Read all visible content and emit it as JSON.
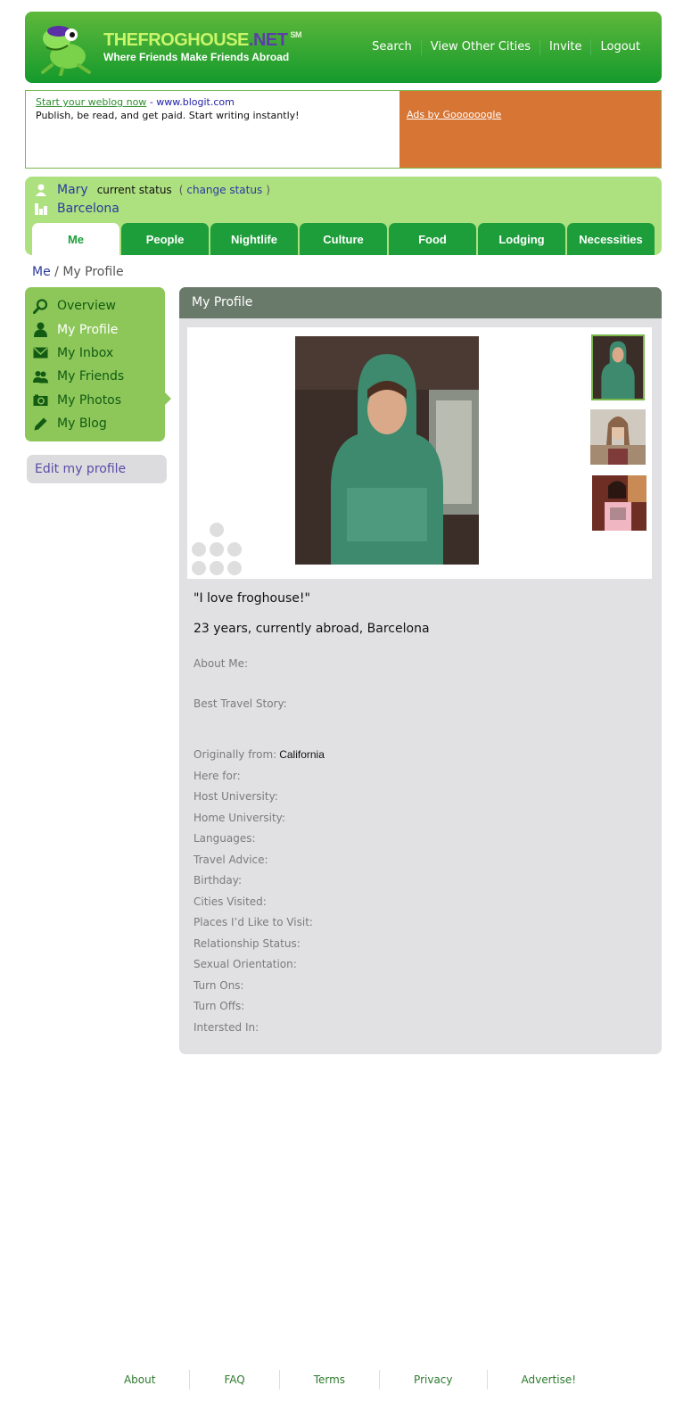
{
  "header": {
    "brand_main": "THEFROGHOUSE",
    "brand_net": ".NET",
    "brand_sm": "SM",
    "tagline": "Where Friends Make Friends Abroad",
    "nav": [
      "Search",
      "View Other Cities",
      "Invite",
      "Logout"
    ]
  },
  "ad": {
    "link_text": "Start your weblog now",
    "url_text": "- www.blogit.com",
    "body": "Publish, be read, and get paid. Start writing instantly!",
    "ads_by": "Ads by Goooooogle"
  },
  "user": {
    "name": "Mary",
    "status_label": "current status",
    "open_paren": "(",
    "change_status": "change status",
    "close_paren": ")",
    "city": "Barcelona"
  },
  "tabs": [
    "Me",
    "People",
    "Nightlife",
    "Culture",
    "Food",
    "Lodging",
    "Necessities"
  ],
  "breadcrumb": {
    "link": "Me",
    "separator": "/",
    "current": "My Profile"
  },
  "sidebar": {
    "items": [
      {
        "label": "Overview",
        "icon": "magnifier-icon"
      },
      {
        "label": "My Profile",
        "icon": "person-icon"
      },
      {
        "label": "My Inbox",
        "icon": "envelope-icon"
      },
      {
        "label": "My Friends",
        "icon": "friends-icon"
      },
      {
        "label": "My Photos",
        "icon": "camera-icon"
      },
      {
        "label": "My Blog",
        "icon": "pencil-icon"
      }
    ],
    "active_index": 1,
    "edit_profile": "Edit my profile"
  },
  "profile": {
    "panel_title": "My Profile",
    "quote": "\"I love froghouse!\"",
    "summary": "23 years, currently abroad, Barcelona",
    "about_me_label": "About Me:",
    "travel_story_label": "Best Travel Story:",
    "fields": [
      {
        "label": "Originally from:",
        "value": "California"
      },
      {
        "label": "Here for:",
        "value": ""
      },
      {
        "label": "Host University:",
        "value": ""
      },
      {
        "label": "Home University:",
        "value": ""
      },
      {
        "label": "Languages:",
        "value": ""
      },
      {
        "label": "Travel Advice:",
        "value": ""
      },
      {
        "label": "Birthday:",
        "value": ""
      },
      {
        "label": "Cities Visited:",
        "value": ""
      },
      {
        "label": "Places I’d Like to Visit:",
        "value": ""
      },
      {
        "label": "Relationship Status:",
        "value": ""
      },
      {
        "label": "Sexual Orientation:",
        "value": ""
      },
      {
        "label": "Turn Ons:",
        "value": ""
      },
      {
        "label": "Turn Offs:",
        "value": ""
      },
      {
        "label": "Intersted In:",
        "value": ""
      }
    ]
  },
  "footer": [
    "About",
    "FAQ",
    "Terms",
    "Privacy",
    "Advertise!"
  ],
  "colors": {
    "header_green": "#149a2c",
    "light_green": "#ade07f",
    "sidebar_green": "#8dc75a",
    "ad_orange": "#d77535",
    "panel_gray": "#e1e1e4",
    "panel_header": "#6a7a6a",
    "link_blue": "#2a3aa0"
  }
}
